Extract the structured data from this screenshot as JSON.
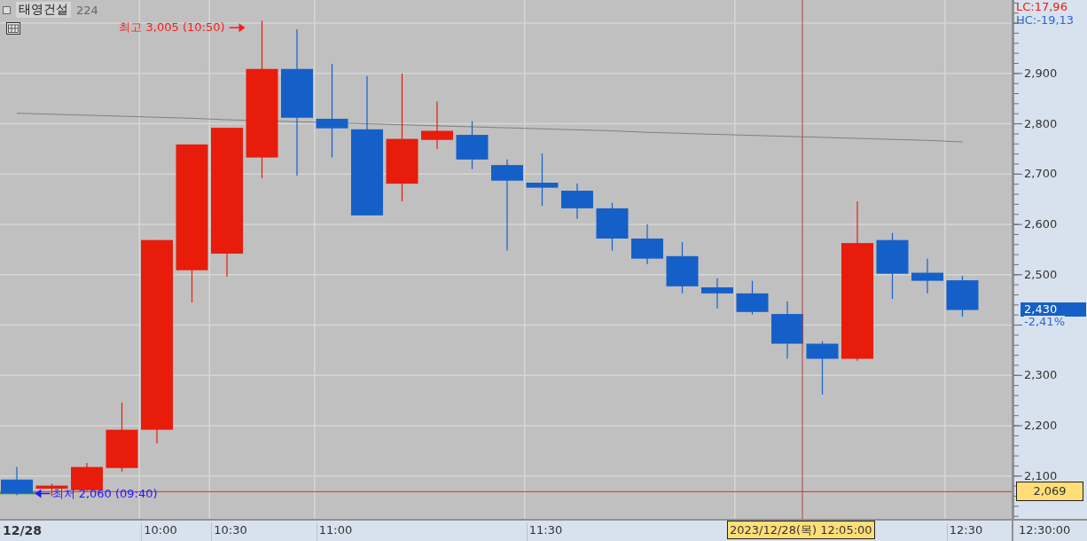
{
  "header": {
    "name": "태영건설",
    "code": "224"
  },
  "indicators": [
    {
      "label": "LC:17,96",
      "color": "#e81c0a"
    },
    {
      "label": "HC:-19,13",
      "color": "#2a66d8"
    }
  ],
  "price_labels": [
    "2,900",
    "2,800",
    "2,700",
    "2,600",
    "2,500",
    "2,300",
    "2,200",
    "2,100"
  ],
  "time_labels": [
    "10:00",
    "10:30",
    "11:00",
    "11:30",
    "12:30"
  ],
  "annotations": [
    "최고 3,005 (10:50)",
    "최저 2,060 (09:40)"
  ],
  "reference_line": {
    "label": "2,069"
  },
  "last_price": {
    "label": "2,430",
    "change": "-2,41%"
  },
  "crosshair": {
    "label": "2023/12/28(목) 12:05:00"
  },
  "date_label": "12/28",
  "axis_corner": "12:30:00"
}
